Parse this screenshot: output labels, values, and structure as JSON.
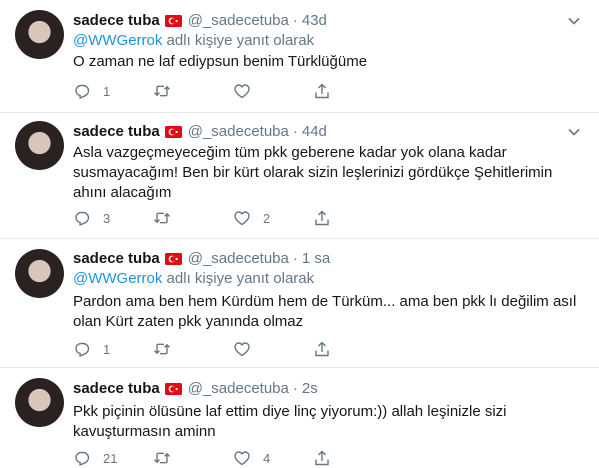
{
  "tweets": [
    {
      "name": "sadece tuba",
      "handle": "@_sadecetuba",
      "time": "43d",
      "reply_prefix": "@WWGerrok",
      "reply_suffix": " adlı kişiye yanıt olarak",
      "text": "O zaman ne laf ediypsun benim Türklüğüme",
      "replies": "1",
      "retweets": "",
      "likes": ""
    },
    {
      "name": "sadece tuba",
      "handle": "@_sadecetuba",
      "time": "44d",
      "reply_prefix": "",
      "reply_suffix": "",
      "text": "Asla vazgeçmeyeceğim tüm pkk geberene kadar yok olana kadar susmayacağım! Ben bir kürt olarak sizin leşlerinizi gördükçe Şehitlerimin ahını alacağım",
      "replies": "3",
      "retweets": "",
      "likes": "2"
    },
    {
      "name": "sadece tuba",
      "handle": "@_sadecetuba",
      "time": "1 sa",
      "reply_prefix": "@WWGerrok",
      "reply_suffix": " adlı kişiye yanıt olarak",
      "text": "Pardon ama ben hem Kürdüm hem de Türküm...  ama ben pkk lı değilim asıl olan Kürt zaten pkk yanında olmaz",
      "replies": "1",
      "retweets": "",
      "likes": ""
    },
    {
      "name": "sadece tuba",
      "handle": "@_sadecetuba",
      "time": "2s",
      "reply_prefix": "",
      "reply_suffix": "",
      "text": "Pkk piçinin ölüsüne laf ettim diye linç yiyorum:)) allah leşinizle sizi kavuşturmasın aminn",
      "replies": "21",
      "retweets": "",
      "likes": "4"
    }
  ],
  "separator": "·",
  "icons": [
    "turkey-flag-icon",
    "chevron-down-icon",
    "reply-icon",
    "retweet-icon",
    "like-icon",
    "share-icon"
  ],
  "colors": {
    "link": "#1b95e0",
    "secondary": "#657786",
    "text": "#14171a",
    "divider": "#e6ecf0",
    "flag_red": "#e30a17"
  }
}
